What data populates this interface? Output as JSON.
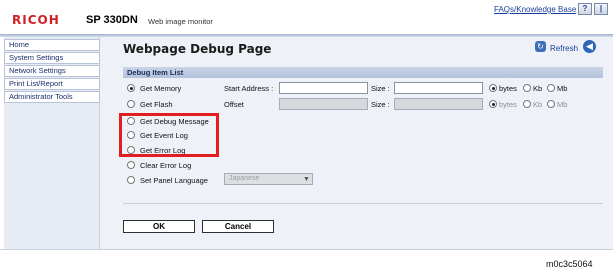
{
  "header": {
    "brand": "RICOH",
    "model": "SP 330DN",
    "subtitle": "Web image monitor",
    "faq_link": "FAQs/Knowledge Base",
    "help_glyph": "?",
    "top_glyph": "|"
  },
  "sidebar": {
    "items": [
      {
        "label": "Home"
      },
      {
        "label": "System Settings"
      },
      {
        "label": "Network Settings"
      },
      {
        "label": "Print List/Report"
      },
      {
        "label": "Administrator Tools"
      }
    ]
  },
  "main": {
    "title": "Webpage Debug Page",
    "refresh_label": "Refresh",
    "section_title": "Debug Item List",
    "options": [
      {
        "label": "Get Memory",
        "checked": true
      },
      {
        "label": "Get Flash",
        "checked": false
      },
      {
        "label": "Get Debug Message",
        "checked": false
      },
      {
        "label": "Get Event Log",
        "checked": false
      },
      {
        "label": "Get Error Log",
        "checked": false
      },
      {
        "label": "Clear Error Log",
        "checked": false
      },
      {
        "label": "Set Panel Language",
        "checked": false
      }
    ],
    "memory_fields": {
      "start_address_label": "Start Address :",
      "size_label": "Size :",
      "units": [
        "bytes",
        "Kb",
        "Mb"
      ],
      "selected_unit": "bytes"
    },
    "flash_fields": {
      "offset_label": "Offset",
      "size_label": "Size :",
      "units": [
        "bytes",
        "Kb",
        "Mb"
      ],
      "selected_unit": "bytes"
    },
    "language_select": {
      "value": "Japanese"
    },
    "buttons": {
      "ok": "OK",
      "cancel": "Cancel"
    }
  },
  "footer": {
    "code": "m0c3c5064"
  },
  "colors": {
    "accent": "#cf1f25",
    "highlight": "#e21e1e",
    "section_bar": "#bccadf"
  }
}
